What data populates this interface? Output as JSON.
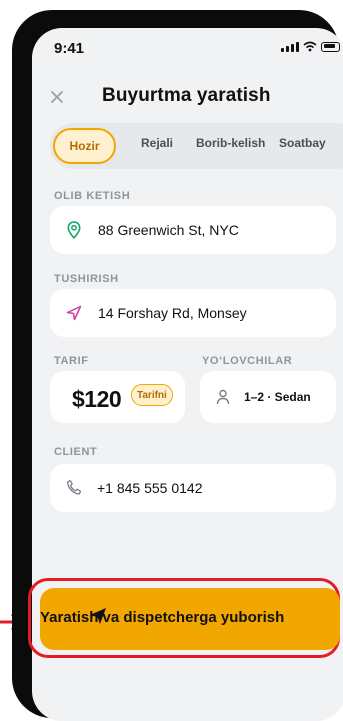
{
  "status_bar": {
    "time": "9:41"
  },
  "header": {
    "title": "Buyurtma yaratish",
    "close_icon": "close-icon"
  },
  "tabs": [
    {
      "label": "Hozir",
      "active": true
    },
    {
      "label": "Rejali",
      "active": false
    },
    {
      "label": "Borib-kelish",
      "active": false
    },
    {
      "label": "Soatbay",
      "active": false
    }
  ],
  "pickup": {
    "label": "OLIB KETISH",
    "value": "88 Greenwich St, NYC",
    "icon": "location-pin-icon",
    "icon_color": "#1aa56a"
  },
  "dropoff": {
    "label": "TUSHIRISH",
    "value": "14 Forshay Rd, Monsey",
    "icon": "navigation-arrow-icon",
    "icon_color": "#d63aa0"
  },
  "tariff": {
    "label": "TARIF",
    "price": "$120",
    "badge": "Tarifni"
  },
  "passengers": {
    "label": "YO‘LOVCHILAR",
    "value": "1–2 · Sedan",
    "icon": "person-icon"
  },
  "client": {
    "label": "CLIENT",
    "phone": "+1 845 555 0142",
    "icon": "phone-icon"
  },
  "cta": {
    "label": "Yaratish va dispetcherga yuborish",
    "icon": "send-icon"
  },
  "colors": {
    "accent": "#f2a600",
    "highlight": "#e31d25",
    "background": "#f1f2f4"
  }
}
